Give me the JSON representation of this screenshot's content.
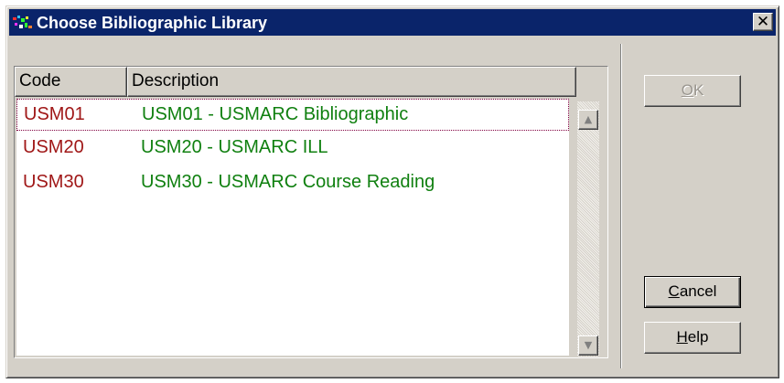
{
  "window": {
    "title": "Choose Bibliographic Library",
    "close_glyph": "✕"
  },
  "list": {
    "columns": [
      "Code",
      "Description"
    ],
    "rows": [
      {
        "code": "USM01",
        "description": "USM01 - USMARC Bibliographic"
      },
      {
        "code": "USM20",
        "description": "USM20 - USMARC ILL"
      },
      {
        "code": "USM30",
        "description": "USM30 - USMARC Course Reading"
      }
    ],
    "focused_row": 0
  },
  "scrollbar": {
    "up_glyph": "▲",
    "down_glyph": "▼"
  },
  "buttons": {
    "ok": {
      "mnemonic": "O",
      "rest": "K",
      "enabled": false
    },
    "cancel": {
      "mnemonic": "C",
      "rest": "ancel",
      "enabled": true
    },
    "help": {
      "mnemonic": "H",
      "rest": "elp",
      "enabled": true
    }
  },
  "colors": {
    "titlebar": "#0a246a",
    "code_text": "#a01818",
    "description_text": "#108010",
    "focus_border": "#800040"
  }
}
